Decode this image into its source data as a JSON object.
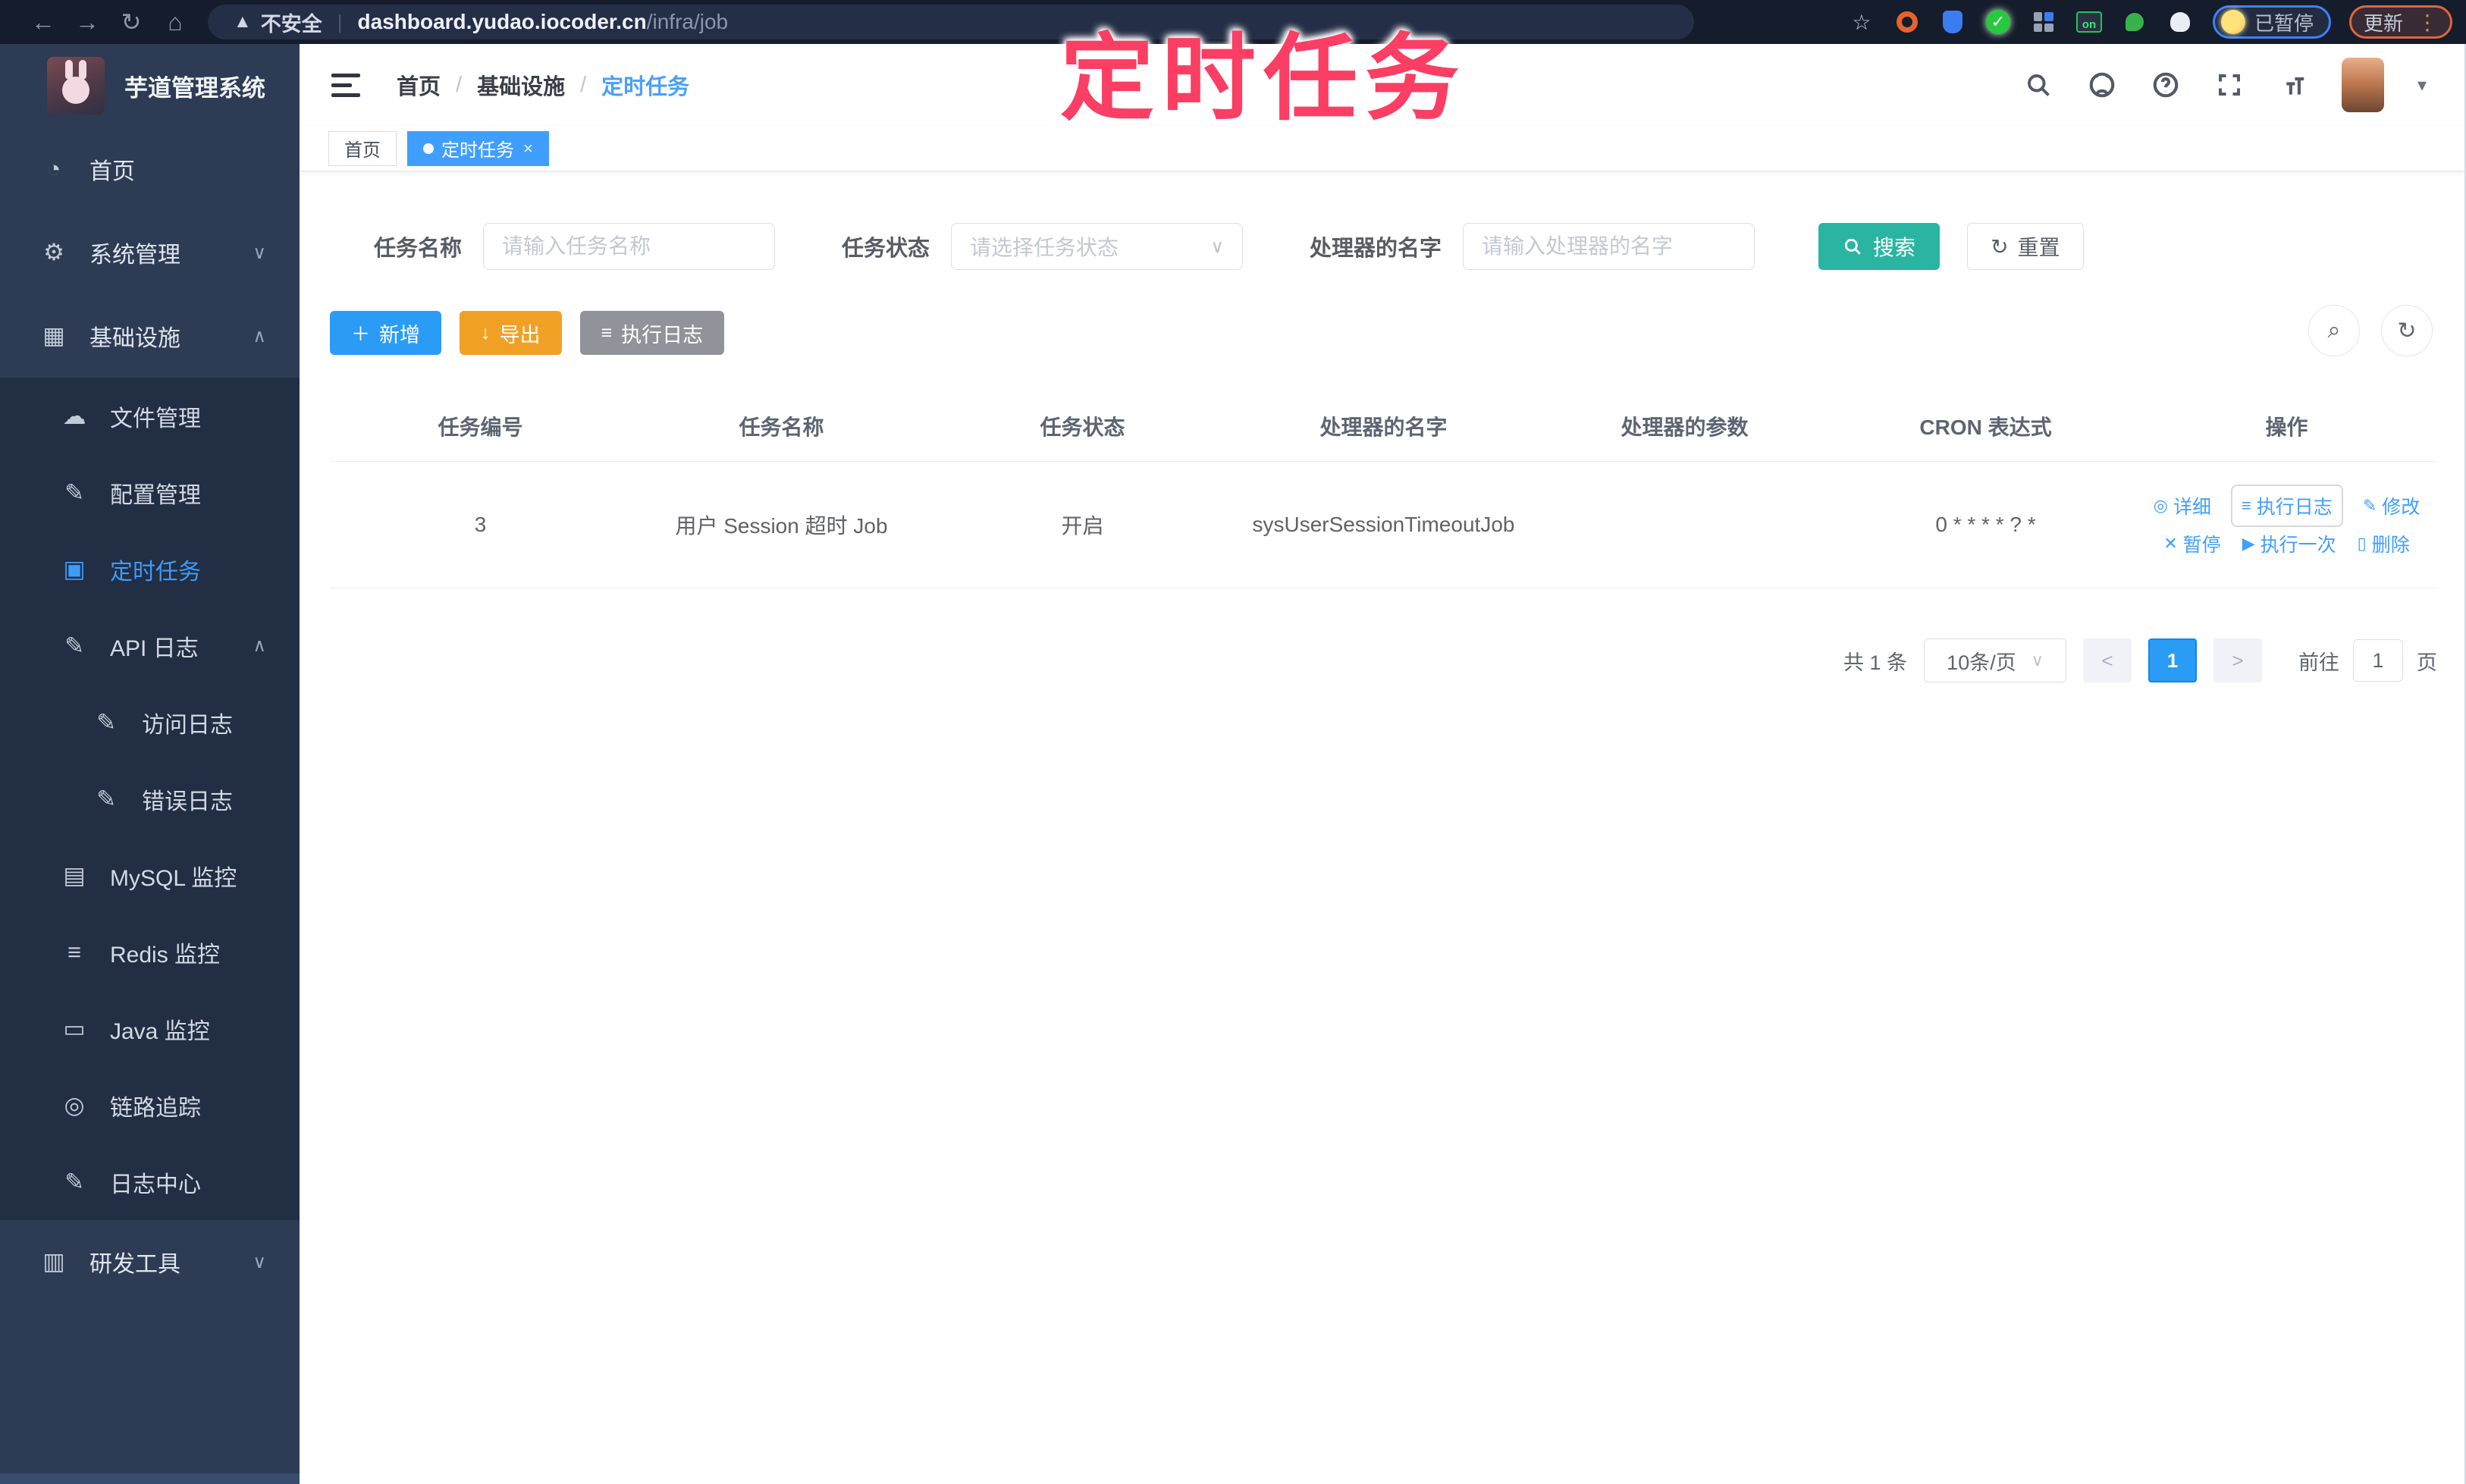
{
  "browser": {
    "security_label": "不安全",
    "url_host": "dashboard.yudao.iocoder.cn",
    "url_path": "/infra/job",
    "paused_badge": "已暂停",
    "update_button": "更新",
    "extensions": [
      "bookmark-star-icon",
      "orange-ring-extension-icon",
      "blue-gem-extension-icon",
      "green-check-extension-icon",
      "grid-extension-icon",
      "on-badge-extension-icon",
      "green-sprout-extension-icon",
      "white-paw-extension-icon"
    ]
  },
  "watermark": "定时任务",
  "sidebar": {
    "title": "芋道管理系统",
    "items": [
      {
        "label": "首页",
        "level": 1,
        "icon": "dashboard-icon"
      },
      {
        "label": "系统管理",
        "level": 1,
        "icon": "gear-icon",
        "chevron": "down"
      },
      {
        "label": "基础设施",
        "level": 1,
        "icon": "monitor-icon",
        "chevron": "up"
      },
      {
        "label": "文件管理",
        "level": 2,
        "icon": "cloud-upload-icon",
        "sub": true
      },
      {
        "label": "配置管理",
        "level": 2,
        "icon": "edit-icon",
        "sub": true
      },
      {
        "label": "定时任务",
        "level": 2,
        "icon": "schedule-icon",
        "sub": true,
        "active": true
      },
      {
        "label": "API 日志",
        "level": 2,
        "icon": "api-log-icon",
        "chevron": "up",
        "sub": true
      },
      {
        "label": "访问日志",
        "level": 3,
        "icon": "access-log-icon",
        "sub": true
      },
      {
        "label": "错误日志",
        "level": 3,
        "icon": "error-log-icon",
        "sub": true
      },
      {
        "label": "MySQL 监控",
        "level": 2,
        "icon": "mysql-icon",
        "sub": true
      },
      {
        "label": "Redis 监控",
        "level": 2,
        "icon": "redis-icon",
        "sub": true
      },
      {
        "label": "Java 监控",
        "level": 2,
        "icon": "java-icon",
        "sub": true
      },
      {
        "label": "链路追踪",
        "level": 2,
        "icon": "trace-icon",
        "sub": true
      },
      {
        "label": "日志中心",
        "level": 2,
        "icon": "log-center-icon",
        "sub": true
      },
      {
        "label": "研发工具",
        "level": 1,
        "icon": "toolbox-icon",
        "chevron": "down"
      }
    ]
  },
  "header": {
    "breadcrumb": [
      "首页",
      "基础设施",
      "定时任务"
    ],
    "tabs": [
      {
        "label": "首页",
        "active": false,
        "closable": false
      },
      {
        "label": "定时任务",
        "active": true,
        "closable": true
      }
    ]
  },
  "filters": {
    "name_label": "任务名称",
    "name_placeholder": "请输入任务名称",
    "status_label": "任务状态",
    "status_placeholder": "请选择任务状态",
    "handler_label": "处理器的名字",
    "handler_placeholder": "请输入处理器的名字",
    "search_label": "搜索",
    "reset_label": "重置"
  },
  "toolbar": {
    "add_label": "新增",
    "export_label": "导出",
    "exec_log_label": "执行日志"
  },
  "table": {
    "headers": [
      "任务编号",
      "任务名称",
      "任务状态",
      "处理器的名字",
      "处理器的参数",
      "CRON 表达式",
      "操作"
    ],
    "rows": [
      {
        "id": "3",
        "name": "用户 Session 超时 Job",
        "status": "开启",
        "handler": "sysUserSessionTimeoutJob",
        "param": "",
        "cron": "0 * * * * ? *",
        "ops": [
          {
            "label": "详细",
            "icon": "eye-icon"
          },
          {
            "label": "执行日志",
            "icon": "log-icon",
            "focused": true
          },
          {
            "label": "修改",
            "icon": "pen-icon"
          },
          {
            "label": "暂停",
            "icon": "pause-icon"
          },
          {
            "label": "执行一次",
            "icon": "play-icon"
          },
          {
            "label": "删除",
            "icon": "trash-icon"
          }
        ]
      }
    ]
  },
  "pagination": {
    "total": "共 1 条",
    "page_size": "10条/页",
    "prev": "<",
    "next": ">",
    "current_page": "1",
    "goto_label": "前往",
    "goto_value": "1",
    "page_unit": "页"
  },
  "icons": {
    "back-icon": "←",
    "forward-icon": "→",
    "reload-icon": "↻",
    "home-icon": "⌂",
    "warning-icon": "▲",
    "kebab-menu-icon": "⋮",
    "caret-down-icon": "▾",
    "dashboard-icon": "◔",
    "gear-icon": "⚙",
    "monitor-icon": "▦",
    "cloud-upload-icon": "☁",
    "edit-icon": "✎",
    "schedule-icon": "▣",
    "api-log-icon": "✎",
    "access-log-icon": "✎",
    "error-log-icon": "✎",
    "mysql-icon": "▤",
    "redis-icon": "≡",
    "java-icon": "▭",
    "trace-icon": "◎",
    "log-center-icon": "✎",
    "toolbox-icon": "▥",
    "chevron-down-icon": "∨",
    "chevron-up-icon": "∧",
    "select-caret-icon": "∨",
    "close-icon": "×",
    "plus-icon": "＋",
    "download-icon": "↓",
    "list-icon": "≡",
    "refresh-icon": "↻",
    "search-toggle-icon": "⌕",
    "eye-icon": "◎",
    "log-icon": "≡",
    "pen-icon": "✎",
    "pause-icon": "✕",
    "play-icon": "▶",
    "trash-icon": "▯"
  },
  "colors": {
    "primary": "#409eff",
    "search_teal": "#2ab5a2",
    "export_amber": "#f0a125",
    "info_gray": "#909399",
    "watermark_pink": "#fb3e63",
    "sidebar_bg": "#2d3b54",
    "submenu_bg": "#212e43"
  }
}
